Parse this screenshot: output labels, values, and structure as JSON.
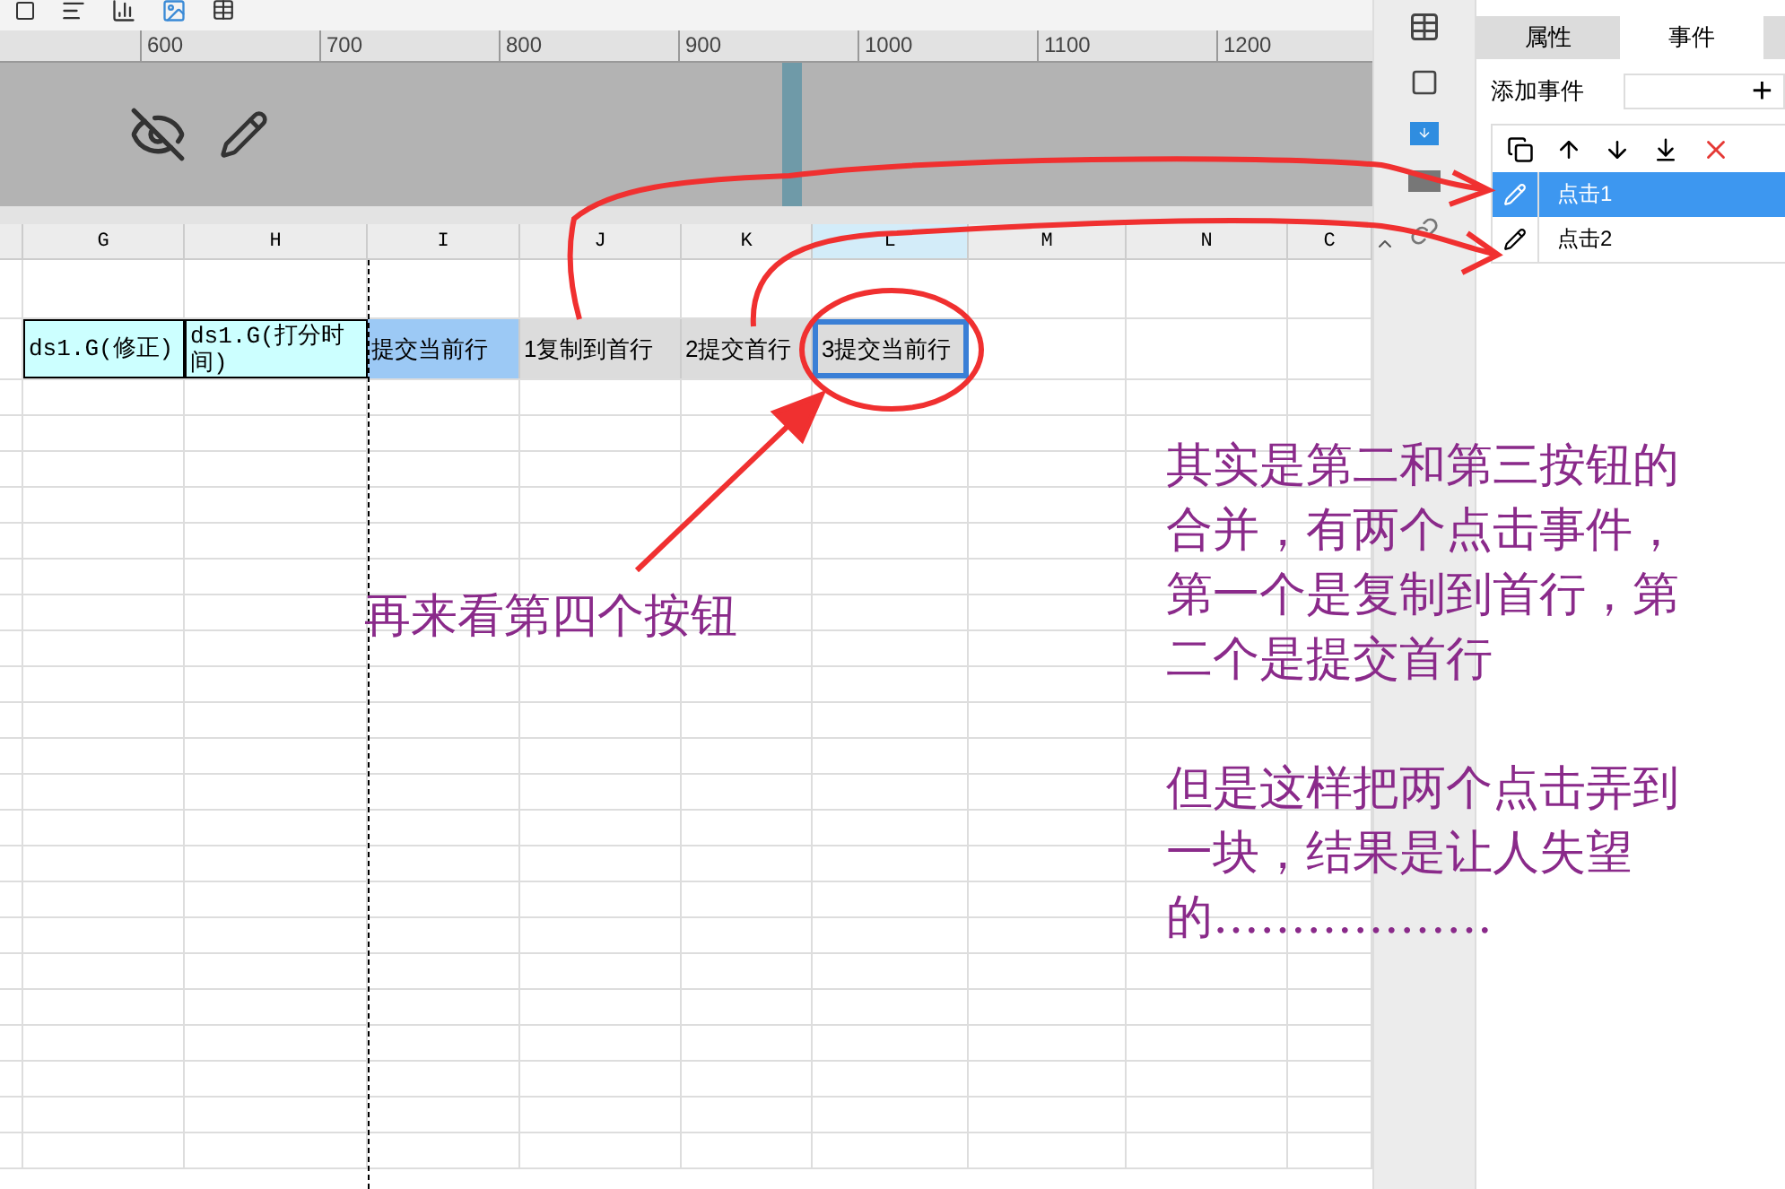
{
  "ruler": {
    "labels": [
      "600",
      "700",
      "800",
      "900",
      "1000",
      "1100",
      "1200"
    ]
  },
  "grid": {
    "columns": [
      {
        "label": "G",
        "selected": false
      },
      {
        "label": "H",
        "selected": false
      },
      {
        "label": "I",
        "selected": false
      },
      {
        "label": "J",
        "selected": false
      },
      {
        "label": "K",
        "selected": false
      },
      {
        "label": "L",
        "selected": true
      },
      {
        "label": "M",
        "selected": false
      },
      {
        "label": "N",
        "selected": false
      },
      {
        "label": "C",
        "selected": false
      }
    ],
    "cells": [
      {
        "kind": "text",
        "text": "ds1.G(修正)"
      },
      {
        "kind": "text",
        "text": "ds1.G(打分时间)"
      },
      {
        "kind": "button",
        "text": "提交当前行",
        "highlighted": true,
        "selected": false
      },
      {
        "kind": "button",
        "text": "1复制到首行",
        "highlighted": false,
        "selected": false
      },
      {
        "kind": "button",
        "text": "2提交首行",
        "highlighted": false,
        "selected": false
      },
      {
        "kind": "button",
        "text": "3提交当前行",
        "highlighted": false,
        "selected": true
      }
    ]
  },
  "panel": {
    "tabs": [
      {
        "label": "属性",
        "selected": false
      },
      {
        "label": "事件",
        "selected": true
      }
    ],
    "add_event": {
      "label": "添加事件",
      "button": "+"
    },
    "events": [
      {
        "label": "点击1",
        "selected": true
      },
      {
        "label": "点击2",
        "selected": false
      }
    ]
  },
  "annotations": {
    "arrow_note": "再来看第四个按钮",
    "paragraphs": [
      "其实是第二和第三按钮的合并，有两个点击事件，第一个是复制到首行，第二个是提交首行",
      "但是这样把两个点击弄到一块，结果是让人失望的………………"
    ]
  }
}
